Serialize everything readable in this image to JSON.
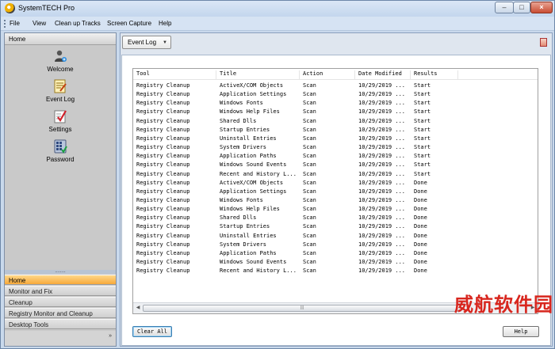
{
  "window": {
    "title": "SystemTECH Pro",
    "min_glyph": "–",
    "max_glyph": "□",
    "close_glyph": "×"
  },
  "menu": [
    "File",
    "View",
    "Clean up Tracks",
    "Screen Capture",
    "Help"
  ],
  "sidebar": {
    "header": "Home",
    "tools": [
      {
        "label": "Welcome",
        "icon": "user-add-icon"
      },
      {
        "label": "Event Log",
        "icon": "event-log-icon"
      },
      {
        "label": "Settings",
        "icon": "settings-checklist-icon"
      },
      {
        "label": "Password",
        "icon": "password-keypad-icon"
      }
    ],
    "splitter_glyph": "........",
    "sections": [
      "Home",
      "Monitor and Fix",
      "Cleanup",
      "Registry Monitor and Cleanup",
      "Desktop Tools"
    ],
    "active_section": "Home",
    "more_glyph": "»"
  },
  "content": {
    "dropdown": {
      "label": "Event Log",
      "caret": "▼"
    },
    "table": {
      "columns": [
        "Tool",
        "Title",
        "Action",
        "Date Modified",
        "Results"
      ],
      "rows": [
        [
          "Registry Cleanup",
          "ActiveX/COM Objects",
          "Scan",
          "10/29/2019 ...",
          "Start"
        ],
        [
          "Registry Cleanup",
          "Application Settings",
          "Scan",
          "10/29/2019 ...",
          "Start"
        ],
        [
          "Registry Cleanup",
          "Windows Fonts",
          "Scan",
          "10/29/2019 ...",
          "Start"
        ],
        [
          "Registry Cleanup",
          "Windows Help Files",
          "Scan",
          "10/29/2019 ...",
          "Start"
        ],
        [
          "Registry Cleanup",
          "Shared Dlls",
          "Scan",
          "10/29/2019 ...",
          "Start"
        ],
        [
          "Registry Cleanup",
          "Startup Entries",
          "Scan",
          "10/29/2019 ...",
          "Start"
        ],
        [
          "Registry Cleanup",
          "Uninstall Entries",
          "Scan",
          "10/29/2019 ...",
          "Start"
        ],
        [
          "Registry Cleanup",
          "System Drivers",
          "Scan",
          "10/29/2019 ...",
          "Start"
        ],
        [
          "Registry Cleanup",
          "Application Paths",
          "Scan",
          "10/29/2019 ...",
          "Start"
        ],
        [
          "Registry Cleanup",
          "Windows Sound Events",
          "Scan",
          "10/29/2019 ...",
          "Start"
        ],
        [
          "Registry Cleanup",
          "Recent and History L...",
          "Scan",
          "10/29/2019 ...",
          "Start"
        ],
        [
          "Registry Cleanup",
          "ActiveX/COM Objects",
          "Scan",
          "10/29/2019 ...",
          "Done"
        ],
        [
          "Registry Cleanup",
          "Application Settings",
          "Scan",
          "10/29/2019 ...",
          "Done"
        ],
        [
          "Registry Cleanup",
          "Windows Fonts",
          "Scan",
          "10/29/2019 ...",
          "Done"
        ],
        [
          "Registry Cleanup",
          "Windows Help Files",
          "Scan",
          "10/29/2019 ...",
          "Done"
        ],
        [
          "Registry Cleanup",
          "Shared Dlls",
          "Scan",
          "10/29/2019 ...",
          "Done"
        ],
        [
          "Registry Cleanup",
          "Startup Entries",
          "Scan",
          "10/29/2019 ...",
          "Done"
        ],
        [
          "Registry Cleanup",
          "Uninstall Entries",
          "Scan",
          "10/29/2019 ...",
          "Done"
        ],
        [
          "Registry Cleanup",
          "System Drivers",
          "Scan",
          "10/29/2019 ...",
          "Done"
        ],
        [
          "Registry Cleanup",
          "Application Paths",
          "Scan",
          "10/29/2019 ...",
          "Done"
        ],
        [
          "Registry Cleanup",
          "Windows Sound Events",
          "Scan",
          "10/29/2019 ...",
          "Done"
        ],
        [
          "Registry Cleanup",
          "Recent and History L...",
          "Scan",
          "10/29/2019 ...",
          "Done"
        ]
      ]
    },
    "scroll": {
      "left": "◀",
      "right": "▶",
      "grip": "|||"
    },
    "buttons": {
      "clear": "Clear All",
      "help": "Help"
    }
  },
  "watermark": "威航软件园",
  "colors": {
    "active_section": "#f7a93a",
    "close_button": "#c94d33",
    "watermark": "#d8261e"
  }
}
